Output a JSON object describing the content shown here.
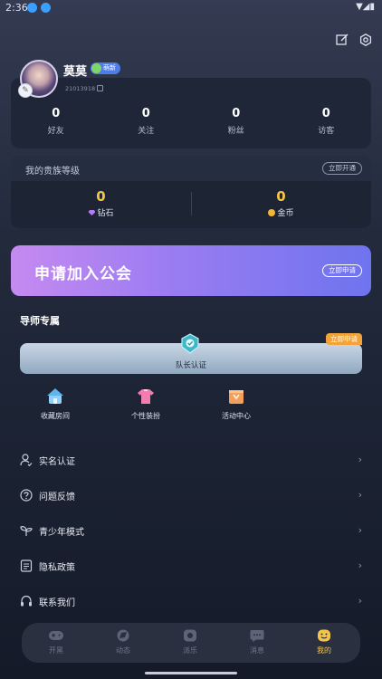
{
  "status_bar": {
    "time": "2:36"
  },
  "profile": {
    "nickname": "莫莫",
    "level_badge": "萌新",
    "user_id": "21013918",
    "stats": [
      {
        "value": "0",
        "label": "好友"
      },
      {
        "value": "0",
        "label": "关注"
      },
      {
        "value": "0",
        "label": "粉丝"
      },
      {
        "value": "0",
        "label": "访客"
      }
    ]
  },
  "noble": {
    "title": "我的贵族等级",
    "open_button": "立即开通",
    "diamond": {
      "value": "0",
      "label": "钻石"
    },
    "coin": {
      "value": "0",
      "label": "金币"
    }
  },
  "guild": {
    "title": "申请加入公会",
    "button": "立即申请"
  },
  "mentor": {
    "title": "导师专属",
    "captain_label": "队长认证",
    "apply_tag": "立即申请",
    "features": [
      {
        "label": "收藏房间",
        "icon": "home-icon"
      },
      {
        "label": "个性装扮",
        "icon": "shirt-icon"
      },
      {
        "label": "活动中心",
        "icon": "gift-icon"
      }
    ]
  },
  "menu": [
    {
      "label": "实名认证",
      "icon": "user-verify-icon"
    },
    {
      "label": "问题反馈",
      "icon": "question-icon"
    },
    {
      "label": "青少年模式",
      "icon": "sprout-icon"
    },
    {
      "label": "隐私政策",
      "icon": "document-icon"
    },
    {
      "label": "联系我们",
      "icon": "headset-icon"
    }
  ],
  "tabs": [
    {
      "label": "开黑",
      "icon": "gamepad-icon"
    },
    {
      "label": "动态",
      "icon": "feed-icon"
    },
    {
      "label": "派乐",
      "icon": "party-icon"
    },
    {
      "label": "消息",
      "icon": "message-icon"
    },
    {
      "label": "我的",
      "icon": "me-icon",
      "active": true
    }
  ],
  "colors": {
    "accent": "#f5c54a",
    "guild_start": "#c58af0",
    "guild_end": "#6e74ee"
  }
}
